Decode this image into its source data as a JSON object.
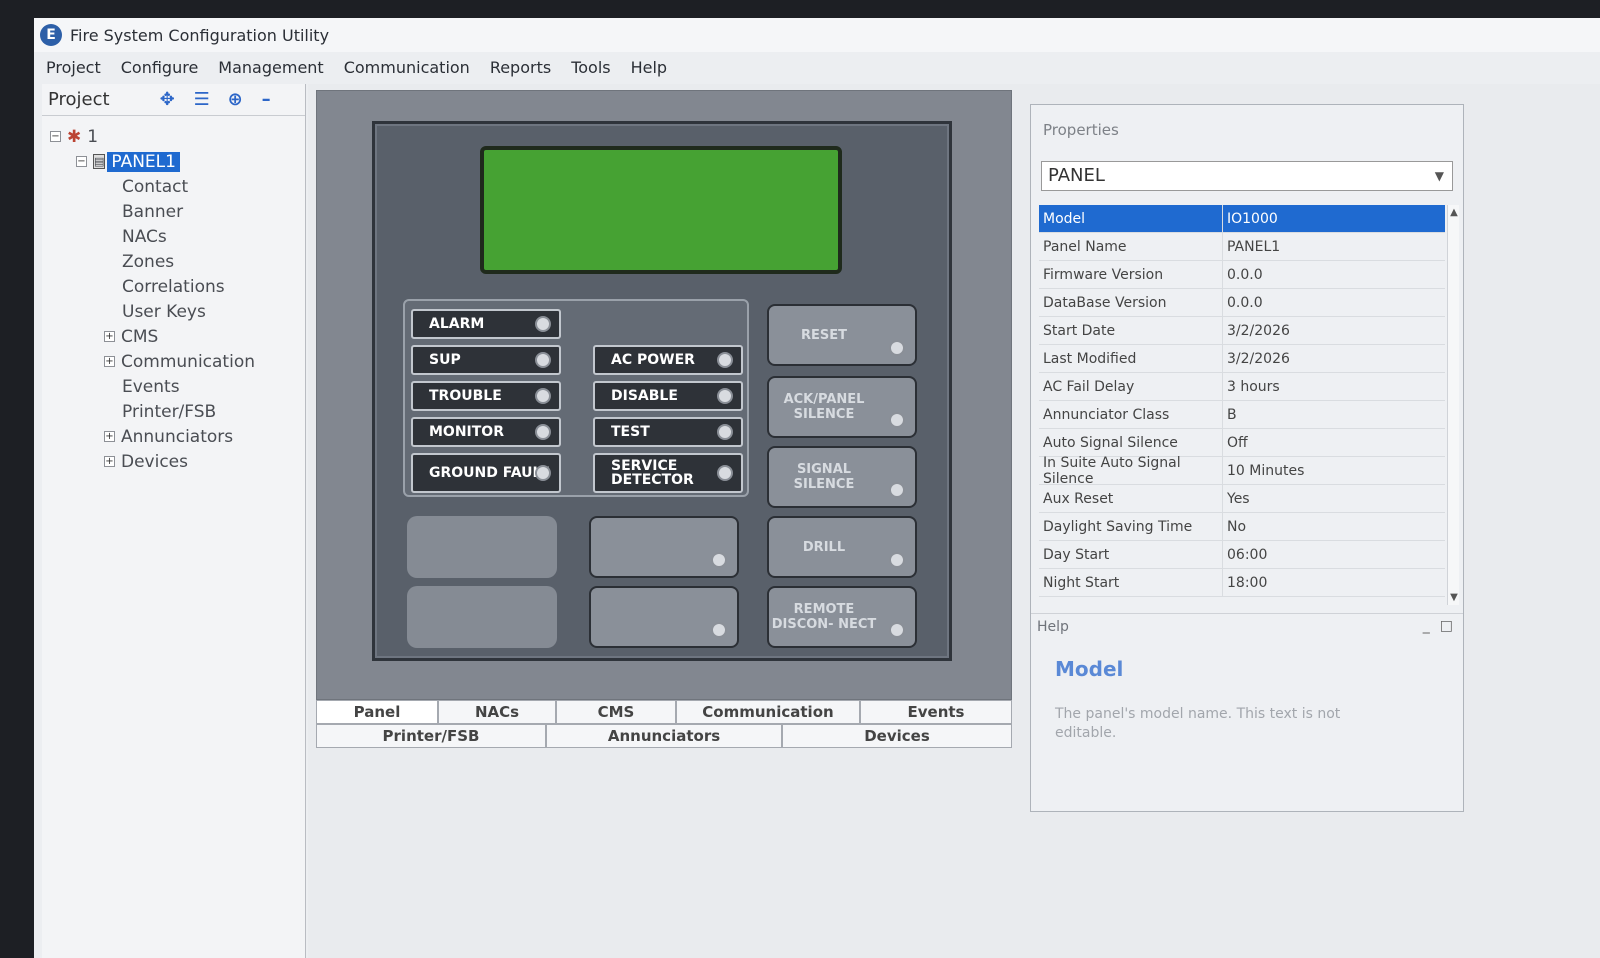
{
  "app": {
    "title": "Fire System Configuration Utility",
    "icon_letter": "E",
    "menu": [
      "Project",
      "Configure",
      "Management",
      "Communication",
      "Reports",
      "Tools",
      "Help"
    ]
  },
  "project": {
    "title": "Project",
    "root_label": "1",
    "panel_label": "PANEL1",
    "items": [
      {
        "label": "Contact",
        "expandable": false
      },
      {
        "label": "Banner",
        "expandable": false
      },
      {
        "label": "NACs",
        "expandable": false
      },
      {
        "label": "Zones",
        "expandable": false
      },
      {
        "label": "Correlations",
        "expandable": false
      },
      {
        "label": "User Keys",
        "expandable": false
      },
      {
        "label": "CMS",
        "expandable": true
      },
      {
        "label": "Communication",
        "expandable": true
      },
      {
        "label": "Events",
        "expandable": false
      },
      {
        "label": "Printer/FSB",
        "expandable": false
      },
      {
        "label": "Annunciators",
        "expandable": true
      },
      {
        "label": "Devices",
        "expandable": true
      }
    ]
  },
  "panel": {
    "left_indicators": [
      "ALARM",
      "SUP",
      "TROUBLE",
      "MONITOR",
      "GROUND FAULT"
    ],
    "right_indicators": [
      "AC POWER",
      "DISABLE",
      "TEST",
      "SERVICE DETECTOR"
    ],
    "buttons": [
      "RESET",
      "ACK/PANEL SILENCE",
      "SIGNAL SILENCE",
      "DRILL",
      "REMOTE DISCON- NECT"
    ],
    "lcd_color": "#46a233"
  },
  "tabs": {
    "row1": [
      "Panel",
      "NACs",
      "CMS",
      "Communication",
      "Events"
    ],
    "row2": [
      "Printer/FSB",
      "Annunciators",
      "Devices"
    ],
    "active": "Panel"
  },
  "properties": {
    "title": "Properties",
    "selector": "PANEL",
    "rows": [
      {
        "key": "Model",
        "value": "IO1000"
      },
      {
        "key": "Panel Name",
        "value": "PANEL1"
      },
      {
        "key": "Firmware Version",
        "value": "0.0.0"
      },
      {
        "key": "DataBase Version",
        "value": "0.0.0"
      },
      {
        "key": "Start Date",
        "value": "3/2/2026"
      },
      {
        "key": "Last Modified",
        "value": "3/2/2026"
      },
      {
        "key": "AC Fail Delay",
        "value": "3 hours"
      },
      {
        "key": "Annunciator Class",
        "value": "B"
      },
      {
        "key": "Auto Signal Silence",
        "value": "Off"
      },
      {
        "key": "In Suite Auto Signal Silence",
        "value": "10 Minutes"
      },
      {
        "key": "Aux Reset",
        "value": "Yes"
      },
      {
        "key": "Daylight Saving Time",
        "value": "No"
      },
      {
        "key": "Day Start",
        "value": "06:00"
      },
      {
        "key": "Night Start",
        "value": "18:00"
      }
    ],
    "selected_key": "Model",
    "help_label": "Help",
    "help_title": "Model",
    "help_text": "The panel's model name. This text is not editable."
  },
  "colors": {
    "selection": "#1f6ad0",
    "help_title": "#5a89d6"
  }
}
